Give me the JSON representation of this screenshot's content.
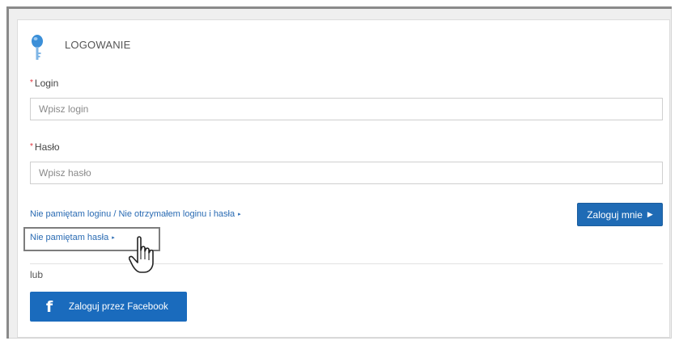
{
  "header": {
    "title": "LOGOWANIE",
    "icon": "key-icon",
    "icon_color": "#3b8fd8"
  },
  "form": {
    "login": {
      "required_mark": "*",
      "label": "Login",
      "placeholder": "Wpisz login",
      "value": ""
    },
    "password": {
      "required_mark": "*",
      "label": "Hasło",
      "placeholder": "Wpisz hasło",
      "value": ""
    }
  },
  "links": {
    "forgot_login": "Nie pamiętam loginu / Nie otrzymałem loginu i hasła",
    "forgot_password": "Nie pamiętam hasła",
    "arrow": "▸"
  },
  "buttons": {
    "login": "Zaloguj mnie",
    "login_arrow": "▶",
    "facebook": "Zaloguj przez Facebook",
    "facebook_icon": "f"
  },
  "separator_text": "lub",
  "colors": {
    "primary": "#1f6bb5",
    "link": "#2a6bb3",
    "required": "#e0303a"
  }
}
